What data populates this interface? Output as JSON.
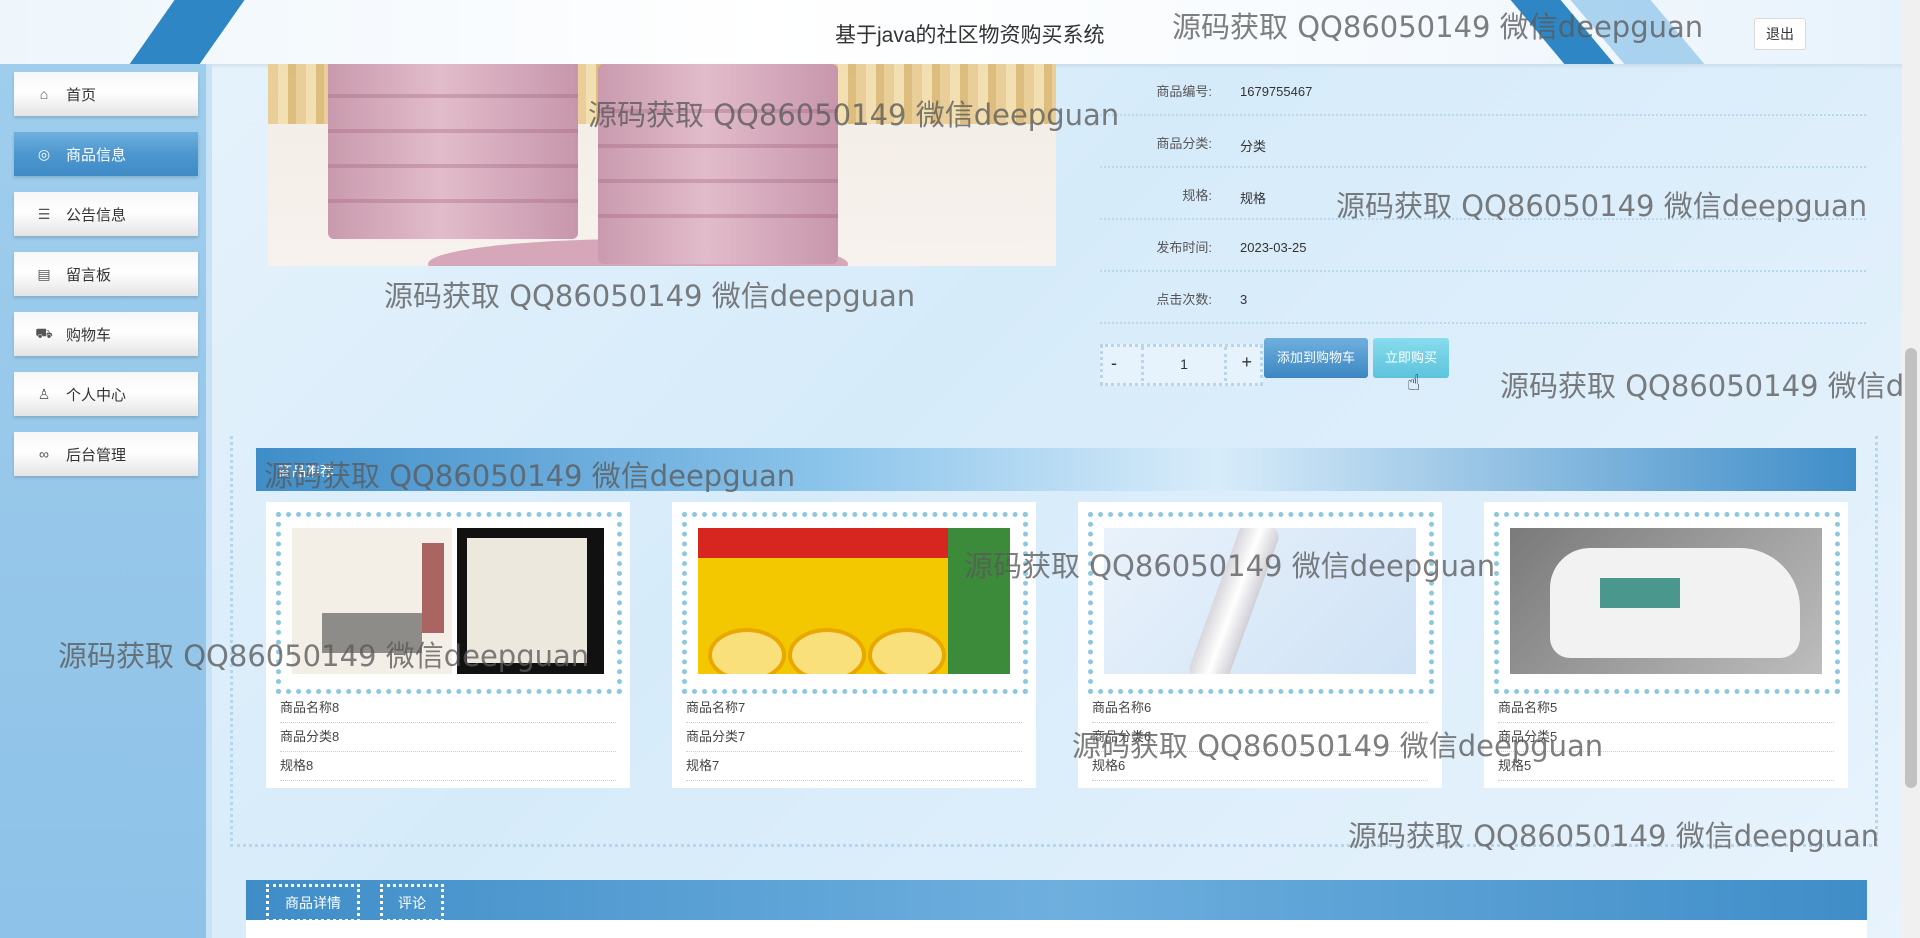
{
  "header": {
    "title": "基于java的社区物资购买系统",
    "logout_label": "退出"
  },
  "sidebar": {
    "items": [
      {
        "label": "首页",
        "icon": "home-icon",
        "active": false
      },
      {
        "label": "商品信息",
        "icon": "goods-icon",
        "active": true
      },
      {
        "label": "公告信息",
        "icon": "notice-icon",
        "active": false
      },
      {
        "label": "留言板",
        "icon": "message-board-icon",
        "active": false
      },
      {
        "label": "购物车",
        "icon": "cart-icon",
        "active": false
      },
      {
        "label": "个人中心",
        "icon": "user-icon",
        "active": false
      },
      {
        "label": "后台管理",
        "icon": "link-icon",
        "active": false
      }
    ]
  },
  "product": {
    "fields": [
      {
        "label": "商品编号:",
        "value": "1679755467"
      },
      {
        "label": "商品分类:",
        "value": "分类"
      },
      {
        "label": "规格:",
        "value": "规格"
      },
      {
        "label": "发布时间:",
        "value": "2023-03-25"
      },
      {
        "label": "点击次数:",
        "value": "3"
      }
    ],
    "quantity": "1",
    "minus_label": "-",
    "plus_label": "+",
    "add_to_cart_label": "添加到购物车",
    "buy_now_label": "立即购买"
  },
  "recommend": {
    "title": "商品推荐",
    "cards": [
      {
        "name": "商品名称8",
        "category": "商品分类8",
        "spec": "规格8"
      },
      {
        "name": "商品名称7",
        "category": "商品分类7",
        "spec": "规格7"
      },
      {
        "name": "商品名称6",
        "category": "商品分类6",
        "spec": "规格6"
      },
      {
        "name": "商品名称5",
        "category": "商品分类5",
        "spec": "规格5"
      }
    ]
  },
  "tabs": [
    {
      "label": "商品详情"
    },
    {
      "label": "评论"
    }
  ],
  "watermark": "源码获取 QQ86050149 微信deepguan",
  "colors": {
    "accent": "#3f8dc8",
    "buy": "#5cc3dc"
  }
}
